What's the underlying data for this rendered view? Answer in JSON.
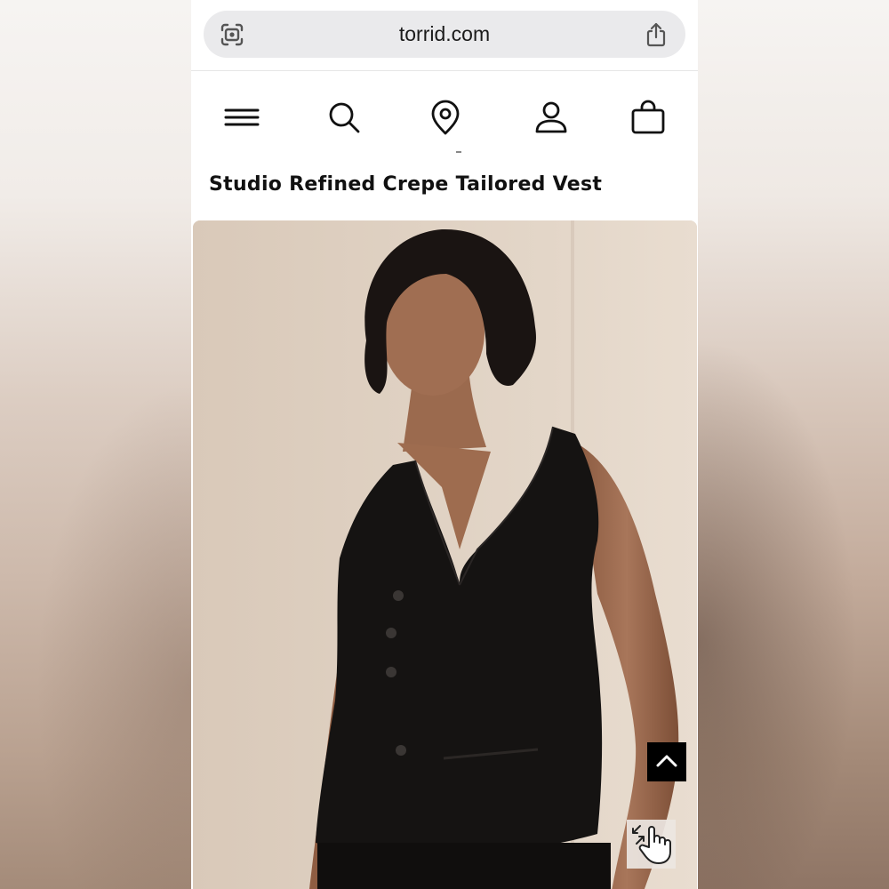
{
  "browser": {
    "url": "torrid.com",
    "icons": [
      "lens-icon",
      "share-icon"
    ]
  },
  "nav": {
    "icons": [
      "menu-icon",
      "search-icon",
      "location-icon",
      "account-icon",
      "bag-icon"
    ]
  },
  "product": {
    "title": "Studio Refined Crepe Tailored Vest",
    "image_description_icon": "product-photo"
  },
  "controls": {
    "scroll_top_icon": "chevron-up-icon",
    "zoom_icon": "pinch-zoom-hand-icon"
  },
  "colors": {
    "text": "#111111",
    "url_bar": "#eaeaec",
    "button_dark": "#000000",
    "vest": "#151312"
  }
}
